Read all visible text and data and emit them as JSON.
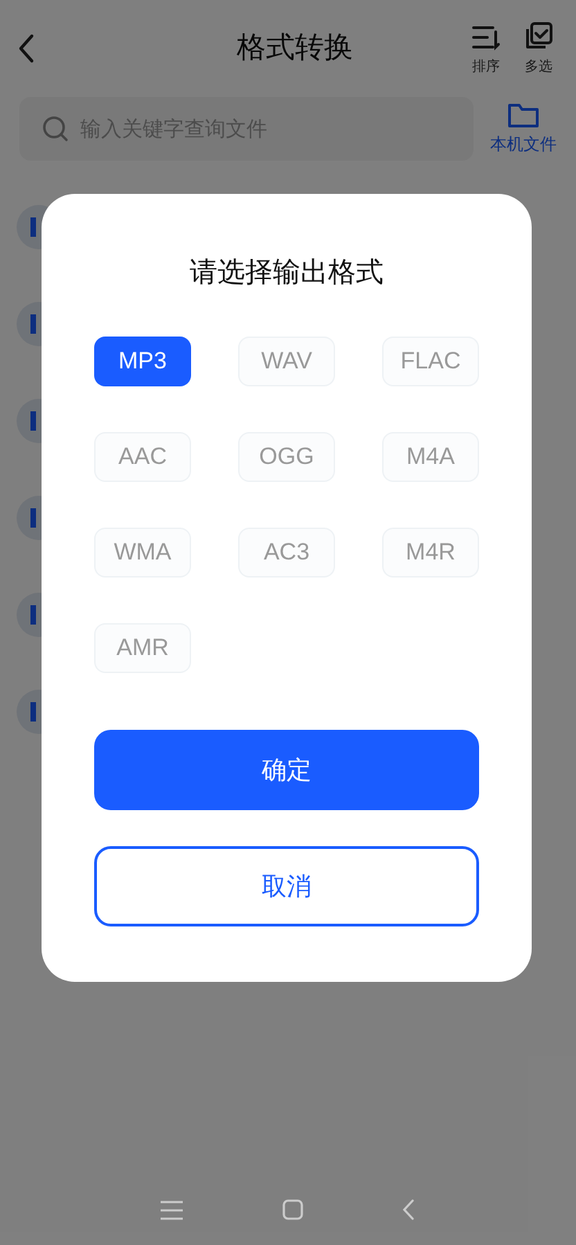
{
  "header": {
    "title": "格式转换",
    "actions": [
      {
        "kind": "sort",
        "label": "排序"
      },
      {
        "kind": "multiselect",
        "label": "多选"
      }
    ]
  },
  "search": {
    "placeholder": "输入关键字查询文件"
  },
  "local_files": {
    "label": "本机文件"
  },
  "dialog": {
    "title": "请选择输出格式",
    "formats": [
      {
        "label": "MP3",
        "selected": true
      },
      {
        "label": "WAV",
        "selected": false
      },
      {
        "label": "FLAC",
        "selected": false
      },
      {
        "label": "AAC",
        "selected": false
      },
      {
        "label": "OGG",
        "selected": false
      },
      {
        "label": "M4A",
        "selected": false
      },
      {
        "label": "WMA",
        "selected": false
      },
      {
        "label": "AC3",
        "selected": false
      },
      {
        "label": "M4R",
        "selected": false
      },
      {
        "label": "AMR",
        "selected": false
      }
    ],
    "confirm": "确定",
    "cancel": "取消"
  }
}
